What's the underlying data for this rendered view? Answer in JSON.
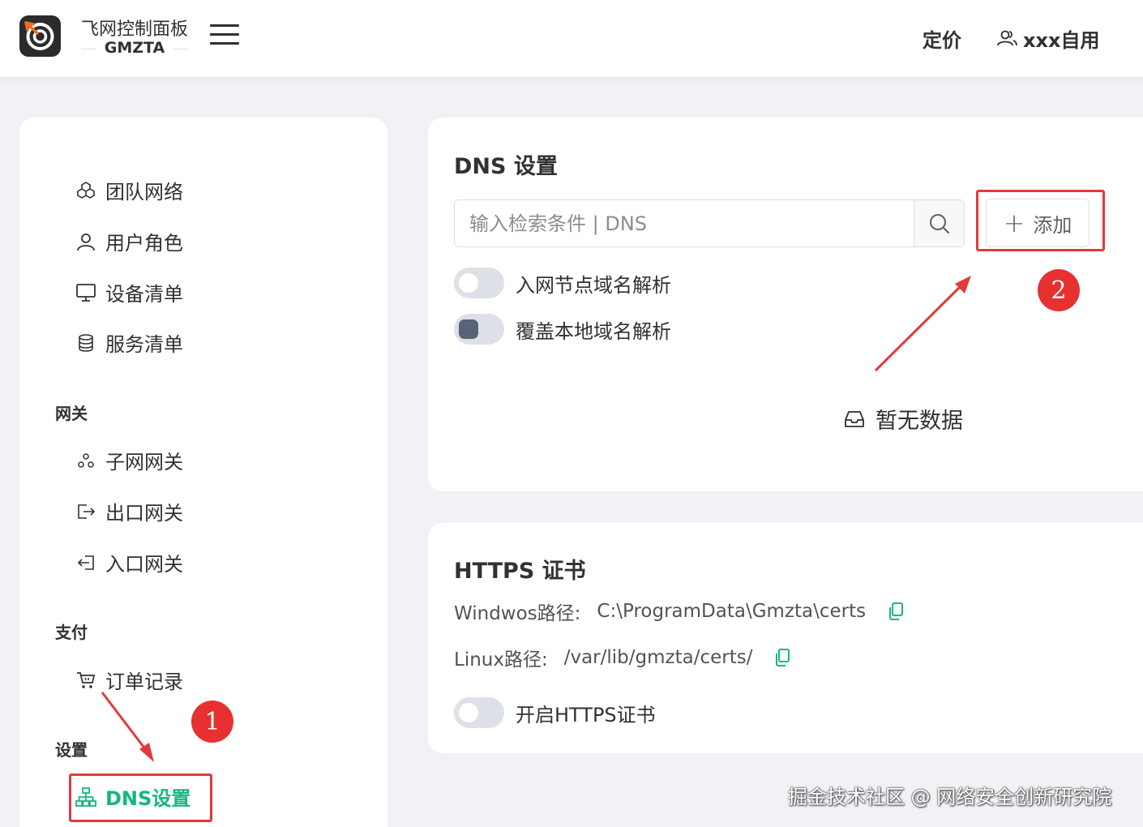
{
  "header": {
    "brand_cn": "飞网控制面板",
    "brand_en": "GMZTA",
    "pricing": "定价",
    "user": "xxx自用"
  },
  "sidebar": {
    "items_top": [
      {
        "label": "团队网络",
        "icon": "cubes-icon"
      },
      {
        "label": "用户角色",
        "icon": "user-icon"
      },
      {
        "label": "设备清单",
        "icon": "monitor-icon"
      },
      {
        "label": "服务清单",
        "icon": "database-icon"
      }
    ],
    "section_gateway": "网关",
    "items_gateway": [
      {
        "label": "子网网关",
        "icon": "subnet-icon"
      },
      {
        "label": "出口网关",
        "icon": "exit-icon"
      },
      {
        "label": "入口网关",
        "icon": "entry-icon"
      }
    ],
    "section_pay": "支付",
    "items_pay": [
      {
        "label": "订单记录",
        "icon": "cart-icon"
      }
    ],
    "section_settings": "设置",
    "items_settings": [
      {
        "label": "DNS设置",
        "icon": "sitemap-icon",
        "active": true
      }
    ]
  },
  "dns_card": {
    "title": "DNS 设置",
    "search_placeholder": "输入检索条件 | DNS",
    "add_label": "添加",
    "toggle1_label": "入网节点域名解析",
    "toggle2_label": "覆盖本地域名解析",
    "empty_text": "暂无数据"
  },
  "https_card": {
    "title": "HTTPS 证书",
    "windows_label": "Windwos路径:",
    "windows_path": "C:\\ProgramData\\Gmzta\\certs",
    "linux_label": "Linux路径:",
    "linux_path": "/var/lib/gmzta/certs/",
    "toggle_label": "开启HTTPS证书"
  },
  "annotations": {
    "badge1": "1",
    "badge2": "2"
  },
  "watermark": "掘金技术社区 @ 网络安全创新研究院",
  "colors": {
    "accent_green": "#14b87c",
    "annotation_red": "#e23a3a",
    "page_bg": "#f0f2f5"
  }
}
